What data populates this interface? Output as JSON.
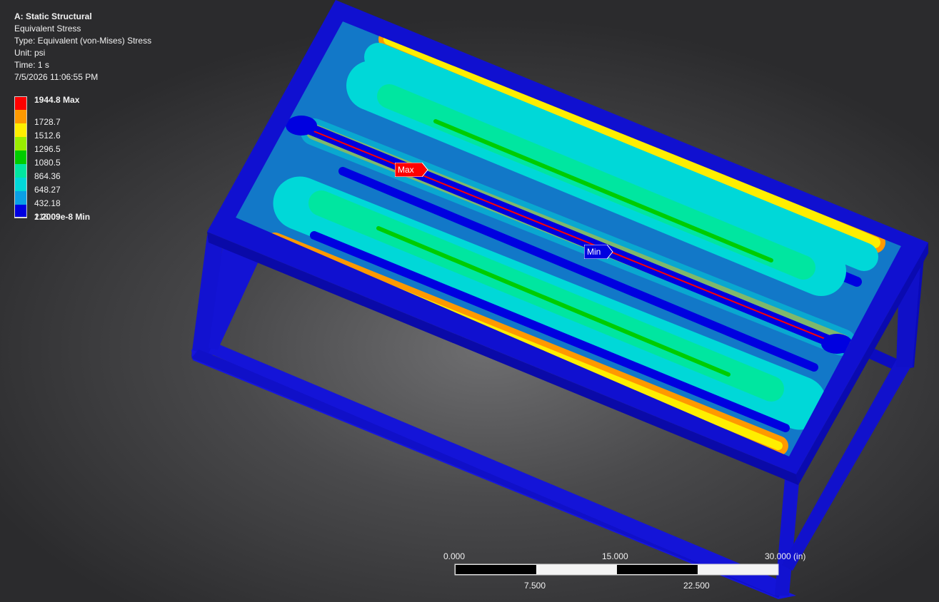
{
  "info": {
    "title": "A: Static Structural",
    "result": "Equivalent Stress",
    "type": "Type: Equivalent (von-Mises) Stress",
    "unit": "Unit: psi",
    "time": "Time: 1 s",
    "timestamp": "7/5/2026 11:06:55 PM"
  },
  "legend": {
    "max_label": "1944.8 Max",
    "min_label": "1.2009e-8 Min",
    "levels": [
      "1944.8 Max",
      "1728.7",
      "1512.6",
      "1296.5",
      "1080.5",
      "864.36",
      "648.27",
      "432.18",
      "216.09"
    ],
    "colors": [
      "#ff0000",
      "#ff9900",
      "#ffee00",
      "#99ee00",
      "#00cc00",
      "#00e6a0",
      "#00d8d8",
      "#0aa0e6",
      "#0000e0"
    ]
  },
  "probes": {
    "max": "Max",
    "min": "Min"
  },
  "scale": {
    "top_labels": [
      "0.000",
      "15.000",
      "30.000 (in)"
    ],
    "bottom_labels": [
      "7.500",
      "22.500"
    ]
  },
  "model": {
    "frame_color": "#1010d0",
    "plate_base_color": "#1278c8"
  }
}
